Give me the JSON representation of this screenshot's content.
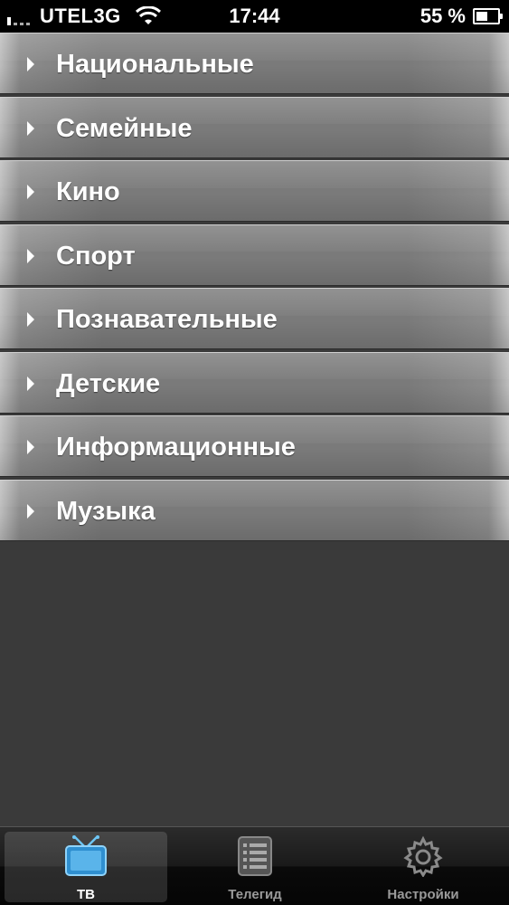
{
  "status_bar": {
    "carrier": "UTEL3G",
    "time": "17:44",
    "battery_percent": "55 %",
    "battery_level": 0.55,
    "signal_bars": 1
  },
  "categories": [
    {
      "label": "Национальные"
    },
    {
      "label": "Семейные"
    },
    {
      "label": "Кино"
    },
    {
      "label": "Спорт"
    },
    {
      "label": "Познавательные"
    },
    {
      "label": "Детские"
    },
    {
      "label": "Информационные"
    },
    {
      "label": "Музыка"
    }
  ],
  "tab_bar": {
    "tabs": [
      {
        "label": "ТВ",
        "icon": "tv-icon",
        "active": true
      },
      {
        "label": "Телегид",
        "icon": "list-icon",
        "active": false
      },
      {
        "label": "Настройки",
        "icon": "gear-icon",
        "active": false
      }
    ]
  },
  "colors": {
    "active_tab_icon": "#3aa0e0",
    "background": "#3a3a3a"
  }
}
